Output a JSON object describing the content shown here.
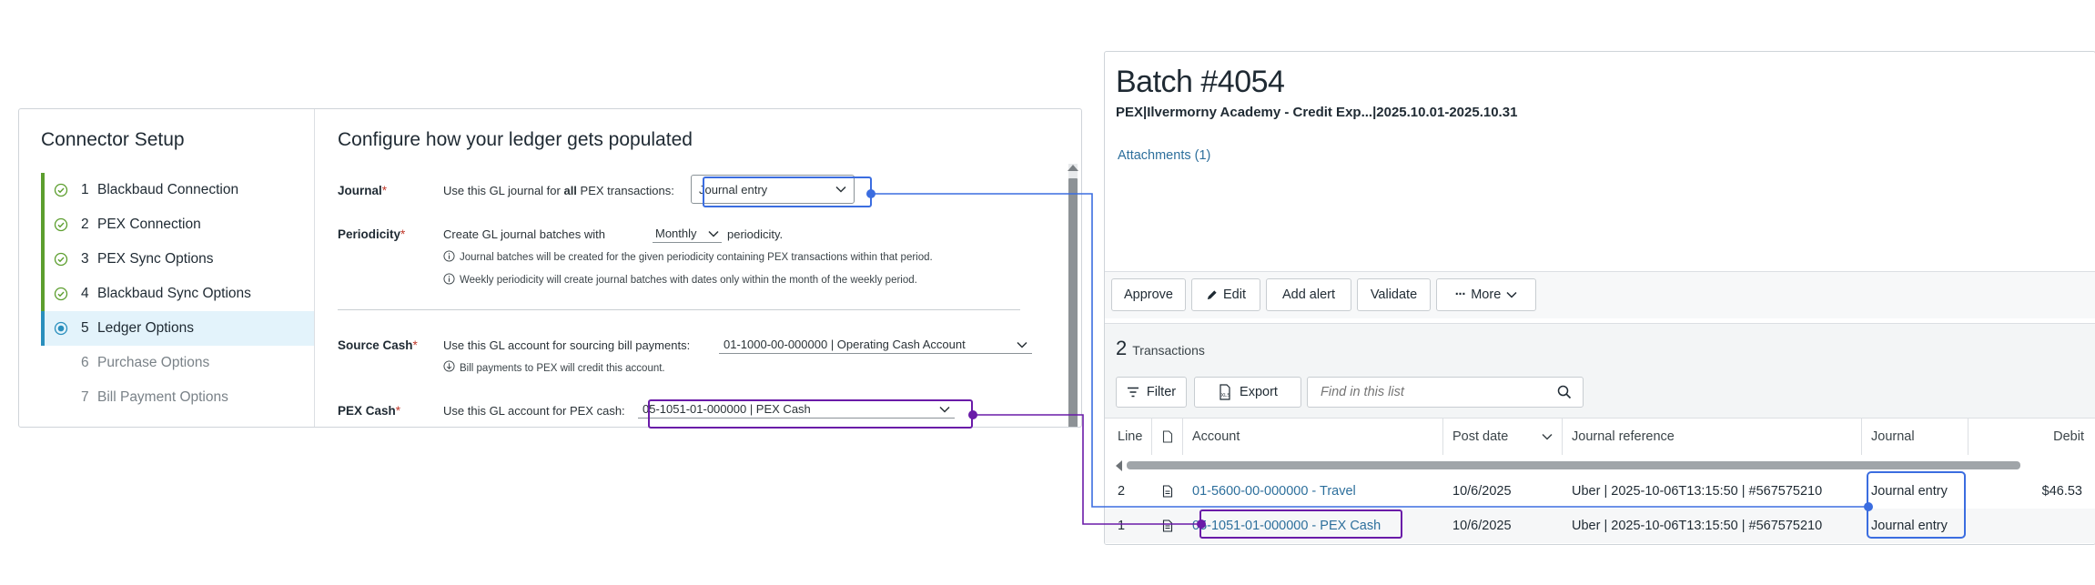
{
  "connector": {
    "title": "Connector Setup",
    "steps": [
      {
        "num": "1",
        "label": "Blackbaud Connection",
        "state": "done"
      },
      {
        "num": "2",
        "label": "PEX Connection",
        "state": "done"
      },
      {
        "num": "3",
        "label": "PEX Sync Options",
        "state": "done"
      },
      {
        "num": "4",
        "label": "Blackbaud Sync Options",
        "state": "done"
      },
      {
        "num": "5",
        "label": "Ledger Options",
        "state": "active"
      },
      {
        "num": "6",
        "label": "Purchase Options",
        "state": "pending"
      },
      {
        "num": "7",
        "label": "Bill Payment Options",
        "state": "pending"
      }
    ]
  },
  "ledger": {
    "title": "Configure how your ledger gets populated",
    "journal": {
      "label": "Journal",
      "req": "*",
      "text_pre": "Use this GL journal for ",
      "text_bold": "all",
      "text_post": " PEX transactions:",
      "value": "Journal entry"
    },
    "periodicity": {
      "label": "Periodicity",
      "req": "*",
      "text_pre": "Create GL journal batches with",
      "value": "Monthly",
      "text_post": "periodicity.",
      "note1": "Journal batches will be created for the given periodicity containing PEX transactions within that period.",
      "note2": "Weekly periodicity will create journal batches with dates only within the month of the weekly period."
    },
    "source_cash": {
      "label": "Source Cash",
      "req": "*",
      "text": "Use this GL account for sourcing bill payments:",
      "value": "01-1000-00-000000 | Operating Cash Account",
      "note": "Bill payments to PEX will credit this account."
    },
    "pex_cash": {
      "label": "PEX Cash",
      "req": "*",
      "text": "Use this GL account for PEX cash:",
      "value": "05-1051-01-000000 | PEX Cash"
    }
  },
  "batch": {
    "title": "Batch #4054",
    "subtitle": "PEX|Ilvermorny Academy - Credit Exp...|2025.10.01-2025.10.31",
    "attachments": "Attachments (1)",
    "toolbar": {
      "approve": "Approve",
      "edit": "Edit",
      "add_alert": "Add alert",
      "validate": "Validate",
      "more": "More"
    },
    "transactions": {
      "count": "2",
      "label": "Transactions",
      "filter": "Filter",
      "export": "Export",
      "search_placeholder": "Find in this list",
      "columns": {
        "line": "Line",
        "account": "Account",
        "post_date": "Post date",
        "journal_reference": "Journal reference",
        "journal": "Journal",
        "debit": "Debit"
      },
      "rows": [
        {
          "line": "2",
          "account": "01-5600-00-000000 - Travel",
          "post_date": "10/6/2025",
          "journal_reference": "Uber | 2025-10-06T13:15:50 | #567575210",
          "journal": "Journal entry",
          "debit": "$46.53"
        },
        {
          "line": "1",
          "account": "05-1051-01-000000 - PEX Cash",
          "post_date": "10/6/2025",
          "journal_reference": "Uber | 2025-10-06T13:15:50 | #567575210",
          "journal": "Journal entry",
          "debit": ""
        }
      ]
    }
  },
  "colors": {
    "blue_connector": "#3b6de0",
    "purple_connector": "#6a1ba8",
    "done_green": "#5c9e2e",
    "active_blue": "#2a8fbd",
    "link_blue": "#2d6f9c"
  }
}
